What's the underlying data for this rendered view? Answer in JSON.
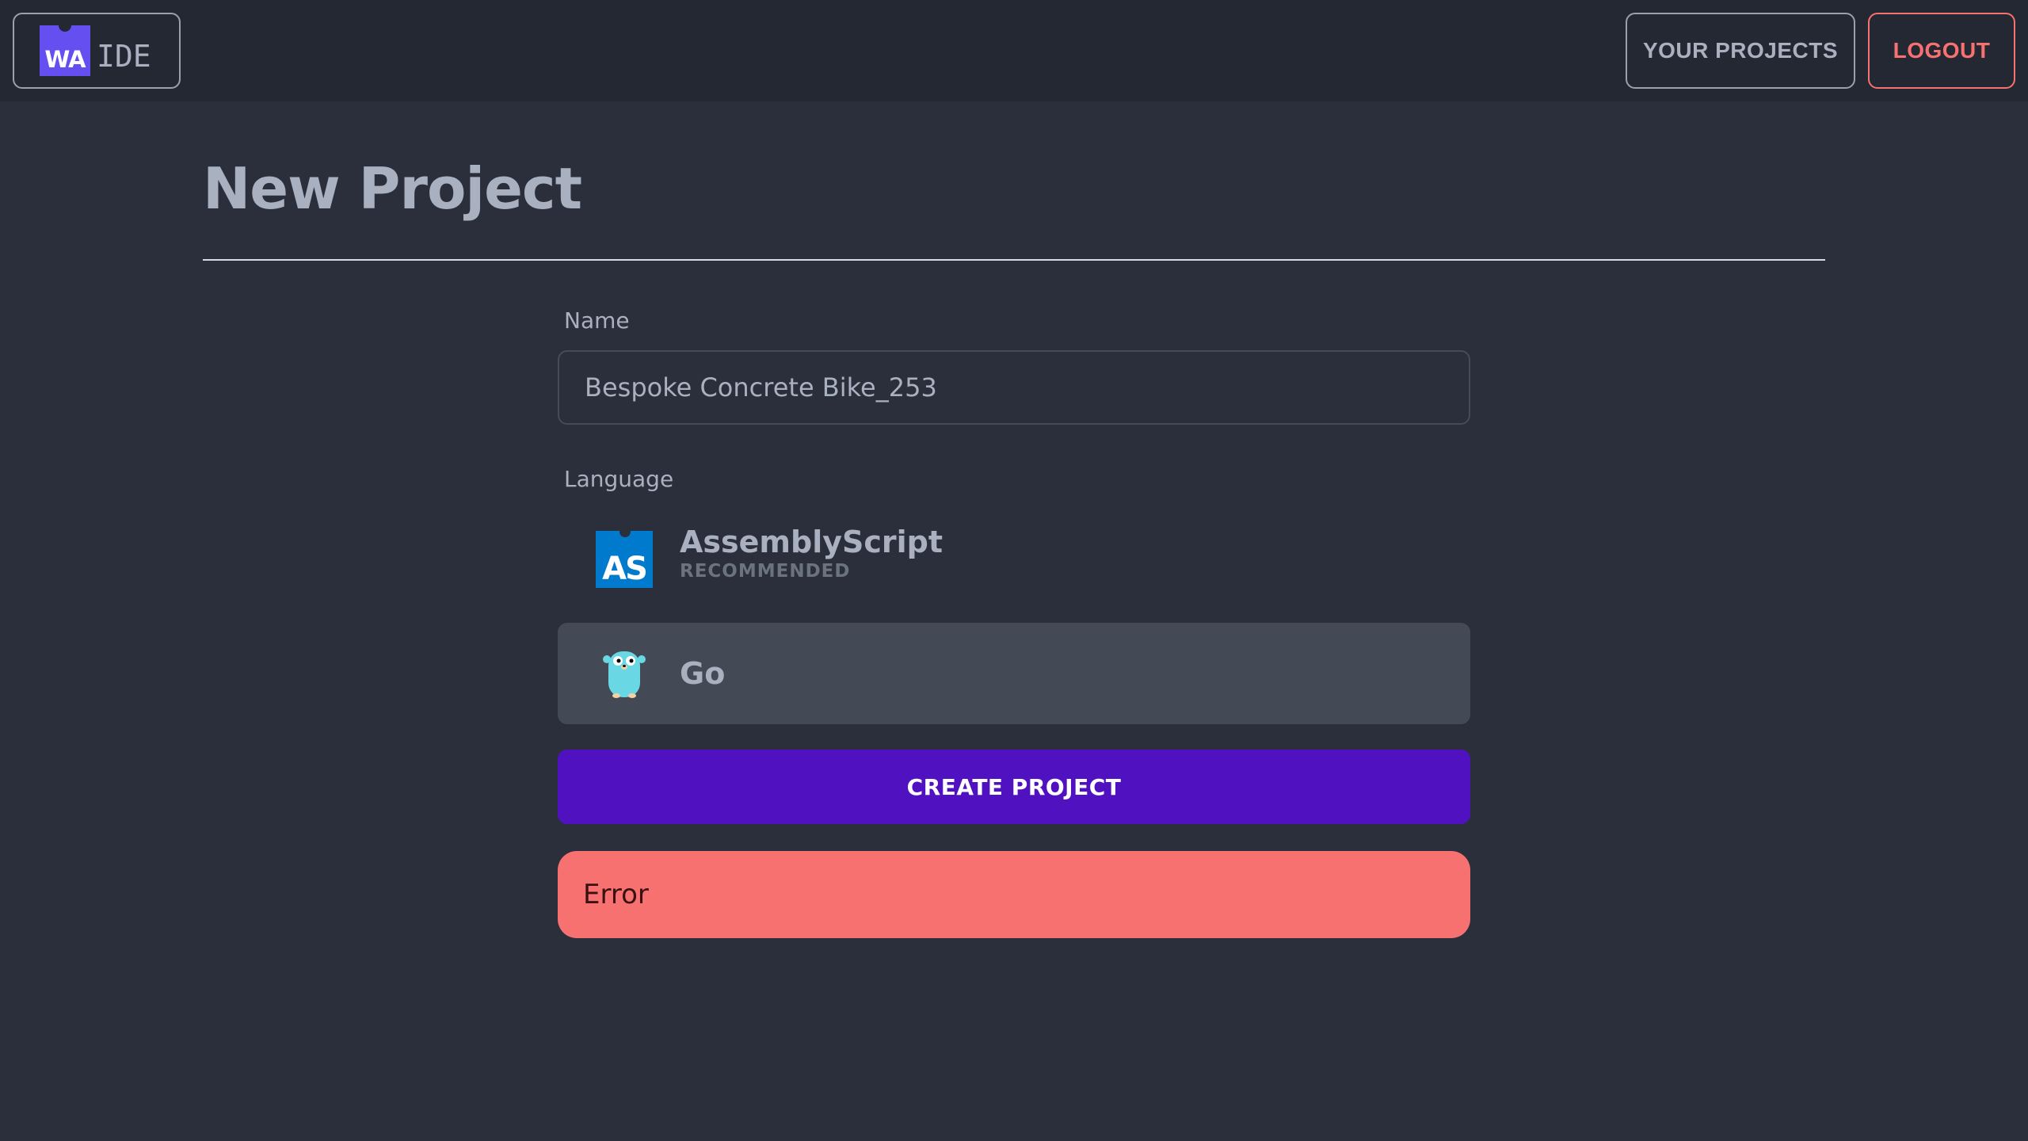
{
  "header": {
    "logo_mark": "WA",
    "logo_text": "IDE",
    "projects_label": "YOUR PROJECTS",
    "logout_label": "LOGOUT"
  },
  "page": {
    "title": "New Project"
  },
  "form": {
    "name_label": "Name",
    "name_value": "Bespoke Concrete Bike_253",
    "language_label": "Language",
    "languages": [
      {
        "name": "AssemblyScript",
        "tag": "RECOMMENDED",
        "icon": "assemblyscript-logo-icon",
        "logo_text": "AS",
        "selected": false
      },
      {
        "name": "Go",
        "tag": "",
        "icon": "go-gopher-icon",
        "selected": true
      }
    ],
    "submit_label": "CREATE PROJECT",
    "error_text": "Error"
  },
  "colors": {
    "background": "#2a2f3b",
    "topbar": "#242833",
    "accent": "#5012c1",
    "logo": "#654ff0",
    "error": "#f87171",
    "assemblyscript": "#007acc"
  }
}
